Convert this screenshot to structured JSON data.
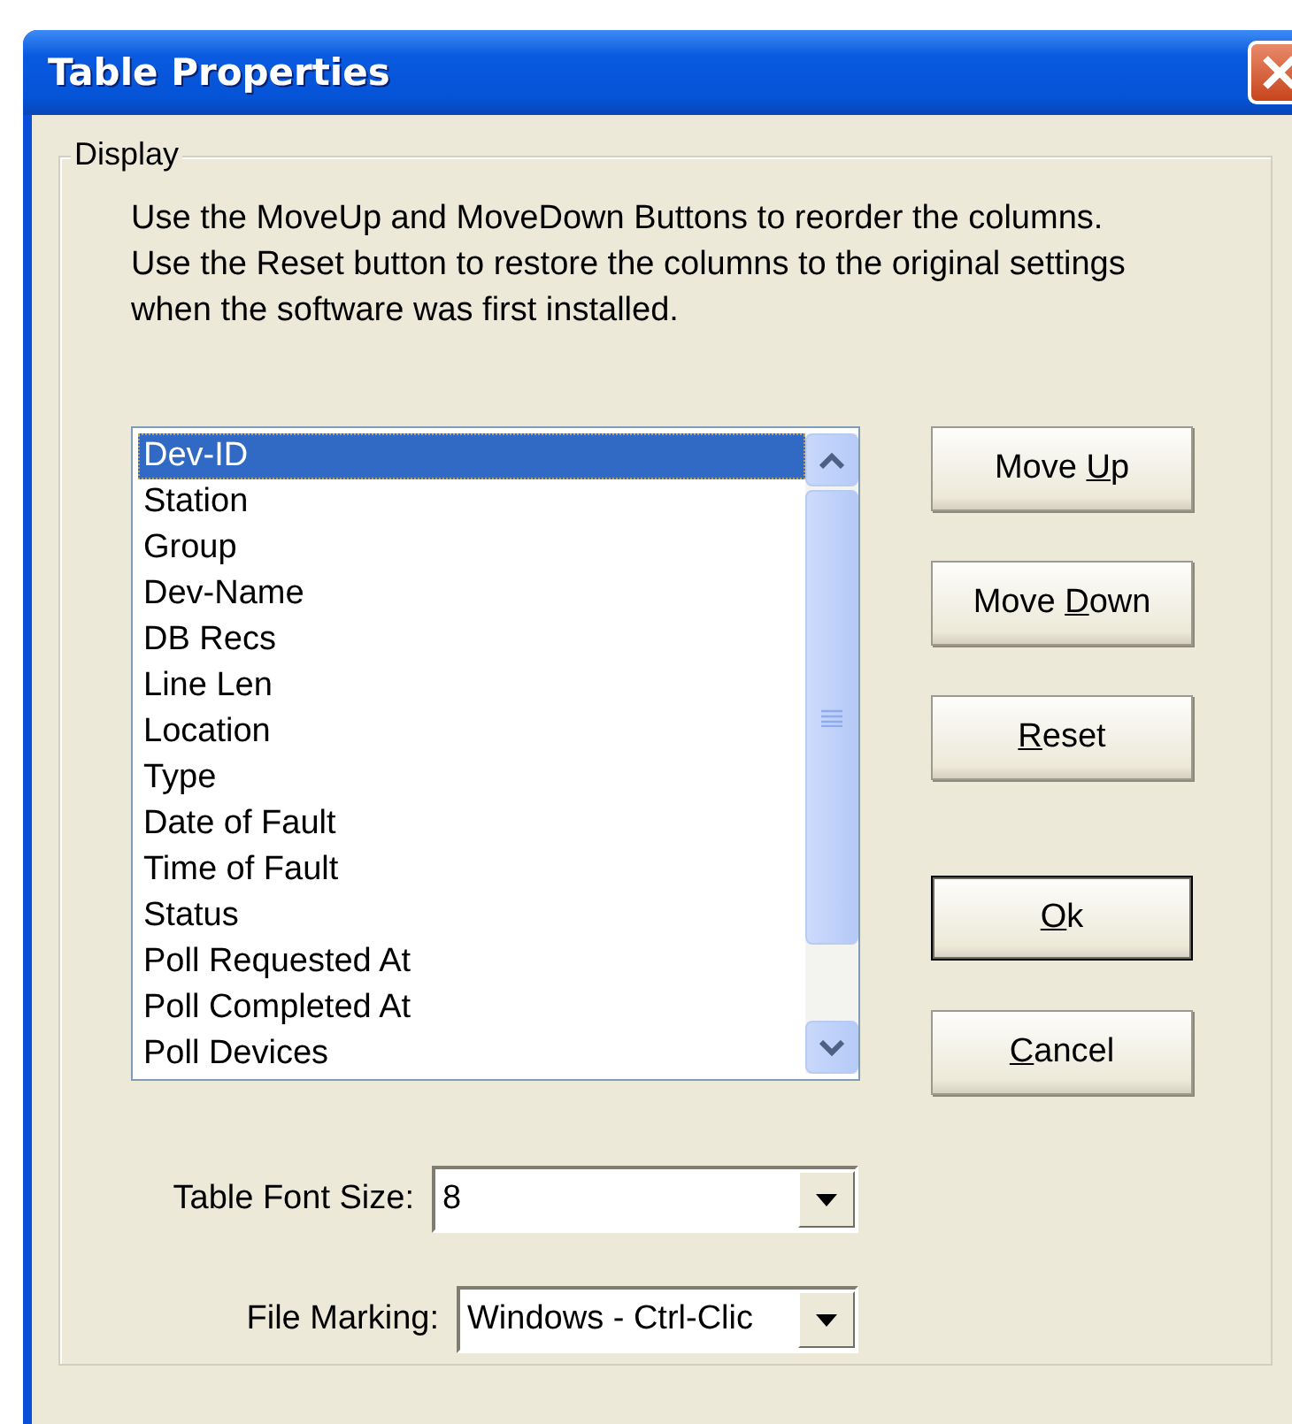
{
  "window": {
    "title": "Table Properties"
  },
  "group": {
    "legend": "Display",
    "instructions": [
      "Use the MoveUp and MoveDown Buttons to reorder the columns.",
      "Use the Reset button to restore the columns to the original settings",
      "when the software was first installed."
    ]
  },
  "columns": [
    {
      "label": "Dev-ID",
      "selected": true
    },
    {
      "label": "Station",
      "selected": false
    },
    {
      "label": "Group",
      "selected": false
    },
    {
      "label": "Dev-Name",
      "selected": false
    },
    {
      "label": "DB Recs",
      "selected": false
    },
    {
      "label": "Line Len",
      "selected": false
    },
    {
      "label": "Location",
      "selected": false
    },
    {
      "label": "Type",
      "selected": false
    },
    {
      "label": "Date of Fault",
      "selected": false
    },
    {
      "label": "Time of Fault",
      "selected": false
    },
    {
      "label": "Status",
      "selected": false
    },
    {
      "label": "Poll Requested At",
      "selected": false
    },
    {
      "label": "Poll Completed At",
      "selected": false
    },
    {
      "label": "Poll Devices",
      "selected": false
    }
  ],
  "buttons": [
    {
      "before": "Move ",
      "key": "U",
      "after": "p",
      "default": false
    },
    {
      "before": "Move ",
      "key": "D",
      "after": "own",
      "default": false
    },
    {
      "key": "R",
      "after": "eset",
      "default": false
    },
    {
      "key": "O",
      "after": "k",
      "default": true
    },
    {
      "key": "C",
      "after": "ancel",
      "default": false
    }
  ],
  "fields": [
    {
      "label": "Table Font Size:",
      "value": "8"
    },
    {
      "label": "File Marking:",
      "value": "Windows - Ctrl-Clic"
    }
  ]
}
